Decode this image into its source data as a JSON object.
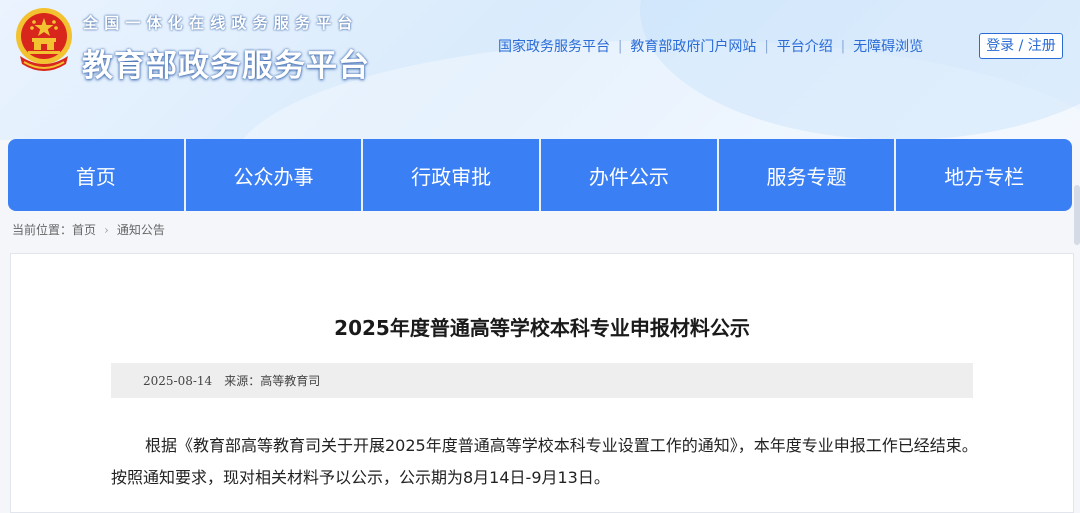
{
  "header": {
    "slogan": "全国一体化在线政务服务平台",
    "site_title": "教育部政务服务平台",
    "links": [
      {
        "label": "国家政务服务平台"
      },
      {
        "label": "教育部政府门户网站"
      },
      {
        "label": "平台介绍"
      },
      {
        "label": "无障碍浏览"
      }
    ],
    "login_label": "登录 / 注册"
  },
  "nav": {
    "items": [
      {
        "label": "首页"
      },
      {
        "label": "公众办事"
      },
      {
        "label": "行政审批"
      },
      {
        "label": "办件公示"
      },
      {
        "label": "服务专题"
      },
      {
        "label": "地方专栏"
      }
    ]
  },
  "breadcrumb": {
    "prefix": "当前位置：",
    "home": "首页",
    "current": "通知公告"
  },
  "article": {
    "title": "2025年度普通高等学校本科专业申报材料公示",
    "date": "2025-08-14",
    "source_label": "来源：",
    "source": "高等教育司",
    "paragraph": "根据《教育部高等教育司关于开展2025年度普通高等学校本科专业设置工作的通知》，本年度专业申报工作已经结束。按照通知要求，现对相关材料予以公示，公示期为8月14日-9月13日。"
  },
  "icons": {
    "emblem": "national-emblem-icon",
    "breadcrumb_separator": "chevron-right-icon"
  },
  "colors": {
    "nav_bg": "#3b7ff5",
    "link": "#2a6bd6",
    "emblem_red": "#d8261c",
    "emblem_gold": "#f2c230"
  }
}
